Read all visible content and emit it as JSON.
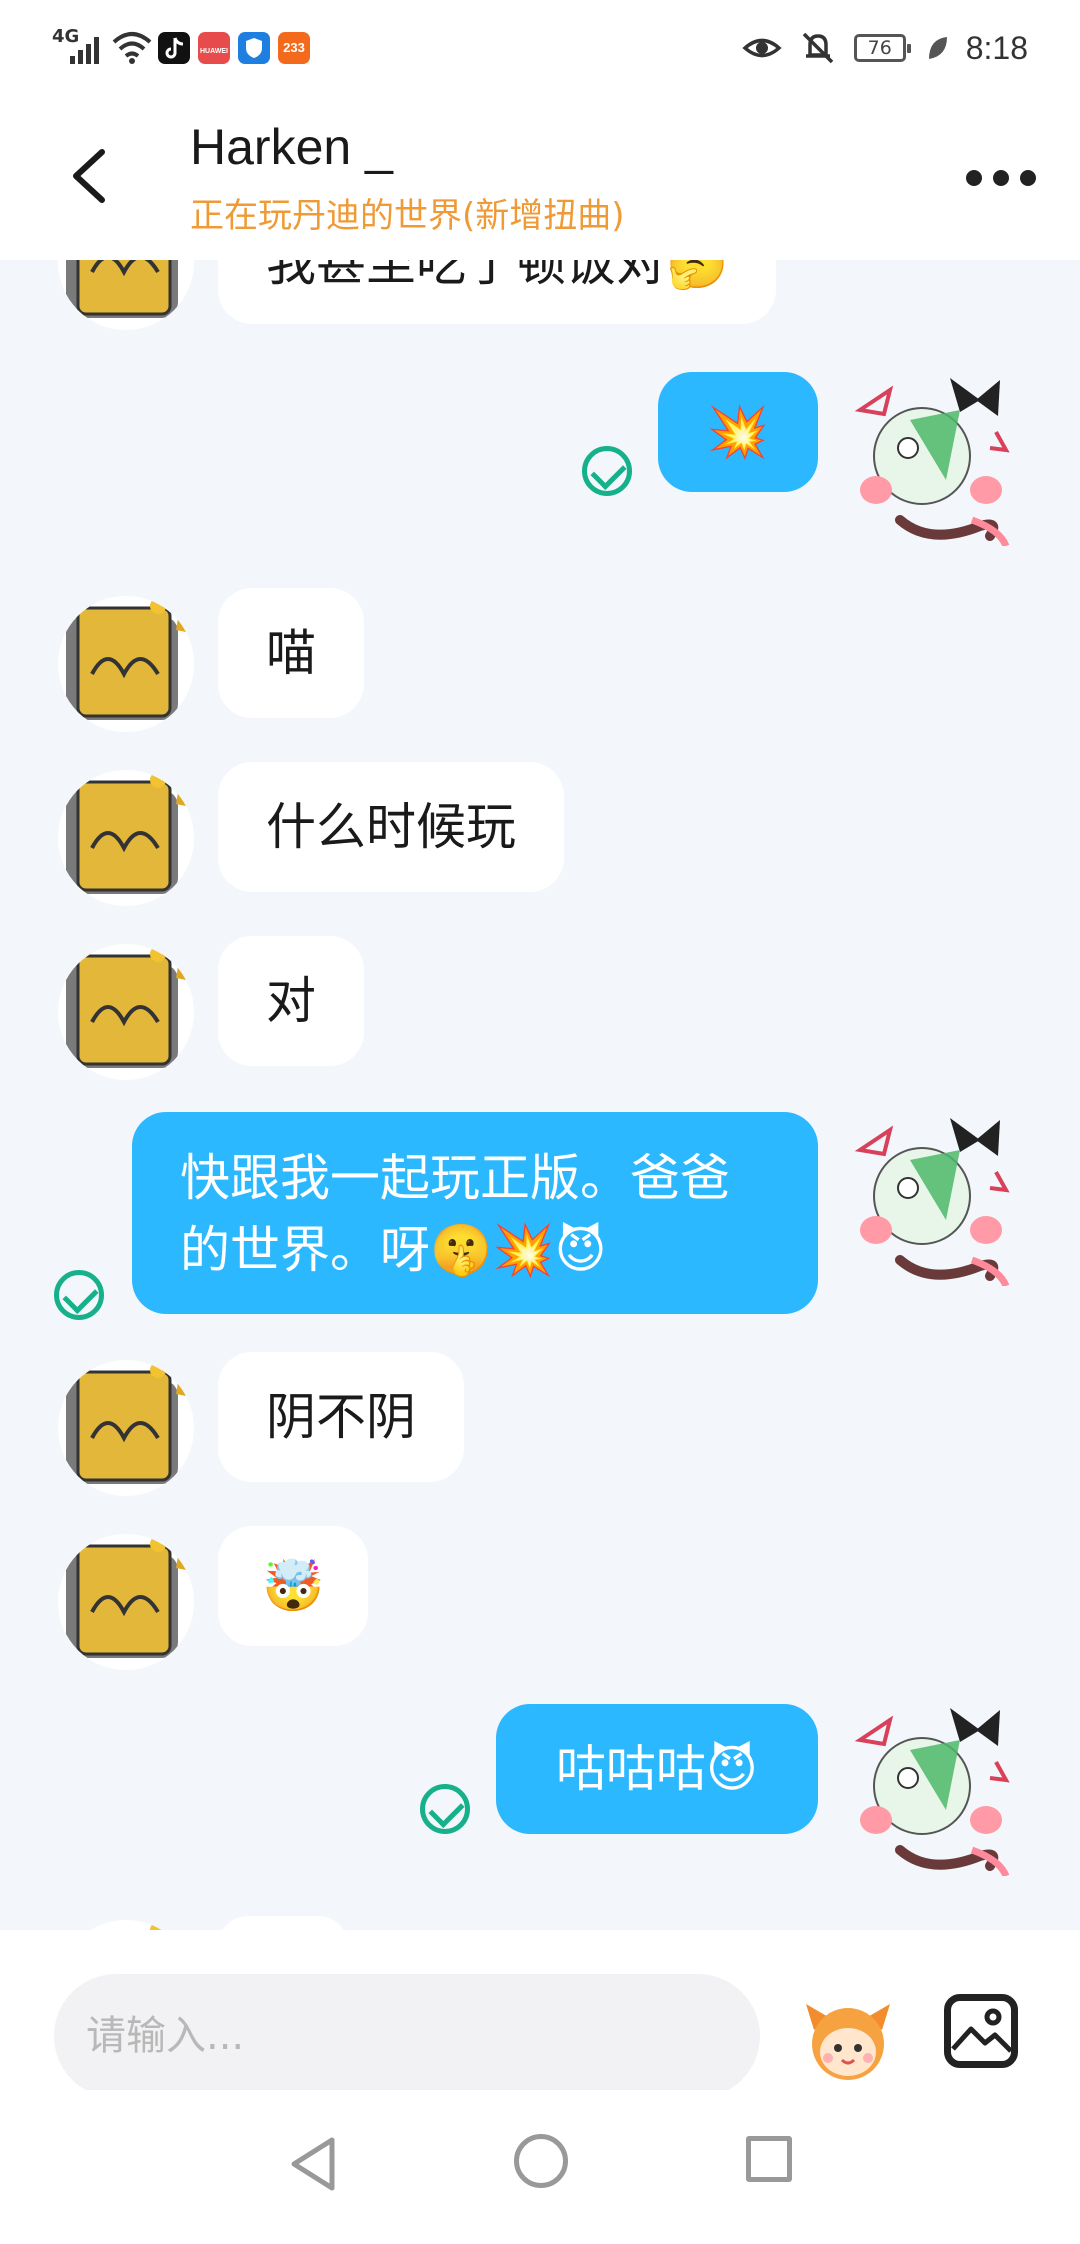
{
  "status_bar": {
    "network": "4G",
    "apps": [
      {
        "name": "tiktok-icon",
        "label": "",
        "color": "#111111"
      },
      {
        "name": "huawei-icon",
        "label": "HUAWEI",
        "color": "#e84b4b"
      },
      {
        "name": "shield-app-icon",
        "label": "",
        "color": "#1e7fe0"
      },
      {
        "name": "app-233-icon",
        "label": "233",
        "color": "#f36a1c"
      }
    ],
    "battery": "76",
    "time": "8:18"
  },
  "header": {
    "title": "Harken _",
    "subtitle": "正在玩丹迪的世界(新增扭曲)"
  },
  "messages": [
    {
      "side": "in",
      "text": "我甚至吃了顿饭对🤔"
    },
    {
      "side": "out",
      "text": "💥",
      "read": true
    },
    {
      "side": "in",
      "text": "喵"
    },
    {
      "side": "in",
      "text": "什么时候玩"
    },
    {
      "side": "in",
      "text": "对"
    },
    {
      "side": "out",
      "text_line1": "快跟我一起玩正版。爸爸",
      "text_line2": "的世界。呀🤫💥😈",
      "read": true
    },
    {
      "side": "in",
      "text": "阴不阴"
    },
    {
      "side": "in",
      "text": "🤯"
    },
    {
      "side": "out",
      "text": "咕咕咕😈",
      "read": true
    }
  ],
  "input": {
    "placeholder": "请输入..."
  },
  "colors": {
    "accent_out_bubble": "#2cb8ff",
    "subtitle_orange": "#f09a35",
    "read_check_green": "#16b18a",
    "chat_bg": "#f3f6fb"
  }
}
